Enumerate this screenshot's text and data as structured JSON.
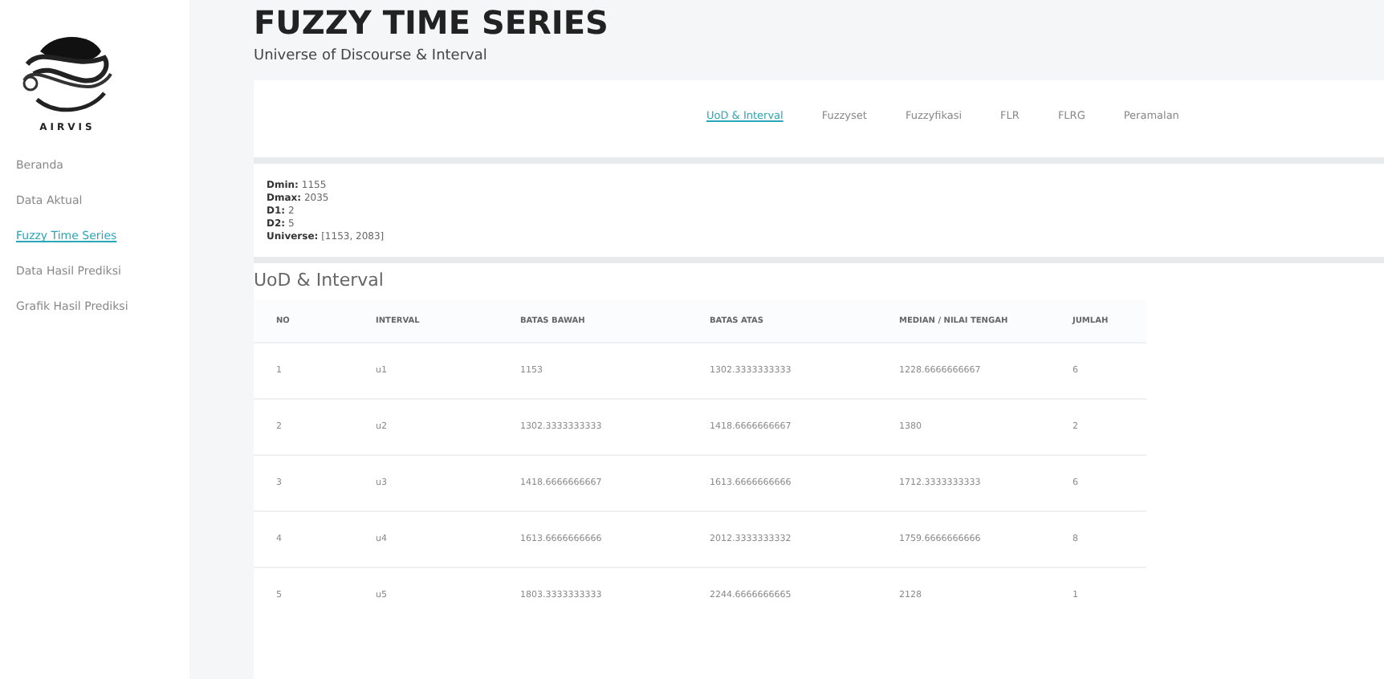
{
  "sidebar": {
    "brand": "AIRVIS",
    "items": [
      {
        "label": "Beranda",
        "selected": false
      },
      {
        "label": "Data Aktual",
        "selected": false
      },
      {
        "label": "Fuzzy Time Series",
        "selected": true
      },
      {
        "label": "Data Hasil Prediksi",
        "selected": false
      },
      {
        "label": "Grafik Hasil Prediksi",
        "selected": false
      }
    ]
  },
  "page": {
    "title": "FUZZY TIME SERIES",
    "subtitle": "Universe of Discourse & Interval"
  },
  "tabs": [
    {
      "label": "UoD & Interval",
      "selected": true
    },
    {
      "label": "Fuzzyset",
      "selected": false
    },
    {
      "label": "Fuzzyfikasi",
      "selected": false
    },
    {
      "label": "FLR",
      "selected": false
    },
    {
      "label": "FLRG",
      "selected": false
    },
    {
      "label": "Peramalan",
      "selected": false
    }
  ],
  "summary": [
    {
      "key": "Dmin:",
      "value": "1155"
    },
    {
      "key": "Dmax:",
      "value": "2035"
    },
    {
      "key": "D1:",
      "value": "2"
    },
    {
      "key": "D2:",
      "value": "5"
    },
    {
      "key": "Universe:",
      "value": "[1153, 2083]"
    }
  ],
  "table": {
    "title": "UoD & Interval",
    "columns": [
      "NO",
      "INTERVAL",
      "BATAS BAWAH",
      "BATAS ATAS",
      "MEDIAN / NILAI TENGAH",
      "JUMLAH"
    ],
    "rows": [
      [
        "1",
        "u1",
        "1153",
        "1302.3333333333",
        "1228.6666666667",
        "6"
      ],
      [
        "2",
        "u2",
        "1302.3333333333",
        "1418.6666666667",
        "1380",
        "2"
      ],
      [
        "3",
        "u3",
        "1418.6666666667",
        "1613.6666666666",
        "1712.3333333333",
        "6"
      ],
      [
        "4",
        "u4",
        "1613.6666666666",
        "2012.3333333332",
        "1759.6666666666",
        "8"
      ],
      [
        "5",
        "u5",
        "1803.3333333333",
        "2244.6666666665",
        "2128",
        "1"
      ]
    ]
  }
}
